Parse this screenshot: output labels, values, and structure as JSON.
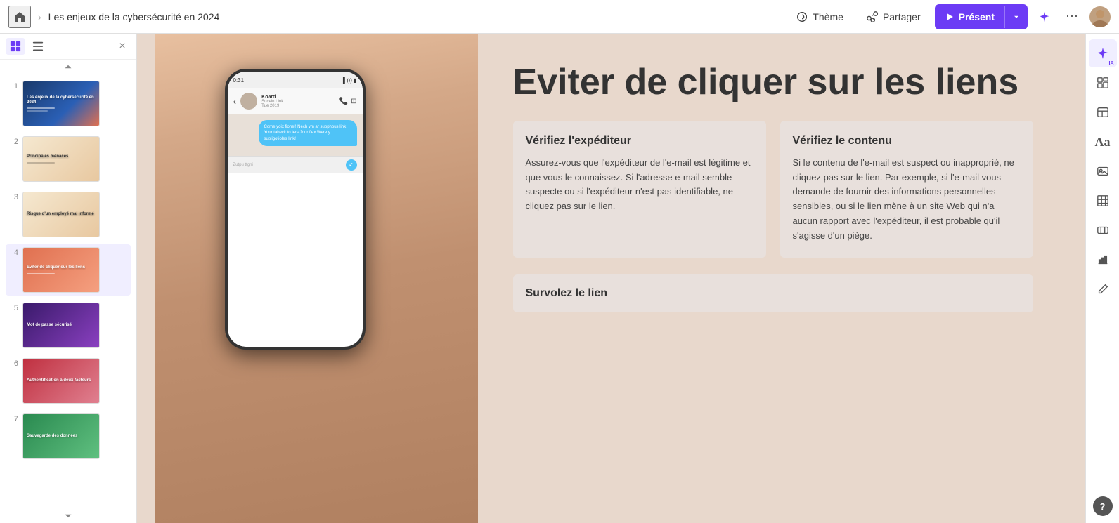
{
  "topbar": {
    "home_icon": "🏠",
    "separator": "›",
    "title": "Les enjeux de la cybersécurité en 2024",
    "theme_label": "Thème",
    "share_label": "Partager",
    "present_label": "Présent",
    "ai_icon_label": "✦",
    "more_icon": "⋯"
  },
  "sidebar": {
    "close_label": "×",
    "slides": [
      {
        "num": "1",
        "title": "Les enjeux de la cybersécurité en 2024"
      },
      {
        "num": "2",
        "title": "Principales menaces"
      },
      {
        "num": "3",
        "title": "Risque d'un employé mal informé"
      },
      {
        "num": "4",
        "title": "Eviter de cliquer sur les liens"
      },
      {
        "num": "5",
        "title": "Mot de passe sécurisé"
      },
      {
        "num": "6",
        "title": "Authentification à deux facteurs"
      },
      {
        "num": "7",
        "title": "Sauvegarde des données"
      }
    ]
  },
  "slide": {
    "title": "Eviter de cliquer sur les liens",
    "card1": {
      "title": "Vérifiez l'expéditeur",
      "body": "Assurez-vous que l'expéditeur de l'e-mail est légitime et que vous le connaissez. Si l'adresse e-mail semble suspecte ou si l'expéditeur n'est pas identifiable, ne cliquez pas sur le lien."
    },
    "card2": {
      "title": "Vérifiez le contenu",
      "body": "Si le contenu de l'e-mail est suspect ou inapproprié, ne cliquez pas sur le lien. Par exemple, si l'e-mail vous demande de fournir des informations personnelles sensibles, ou si le lien mène à un site Web qui n'a aucun rapport avec l'expéditeur, il est probable qu'il s'agisse d'un piège."
    },
    "survolez": {
      "title": "Survolez le lien"
    }
  },
  "phone": {
    "time": "0:31",
    "contact_name": "Koard",
    "contact_sub": "Sucein Link",
    "contact_date": "Tue 2019",
    "message1": "Come yoix fionel! Nech vm ar supphous link Your tabeck to lers Jour flex Were y supligotioles link!",
    "input_placeholder": "Zutpu ttgni"
  },
  "right_panel": {
    "ai_label": "IA",
    "help_label": "?"
  }
}
